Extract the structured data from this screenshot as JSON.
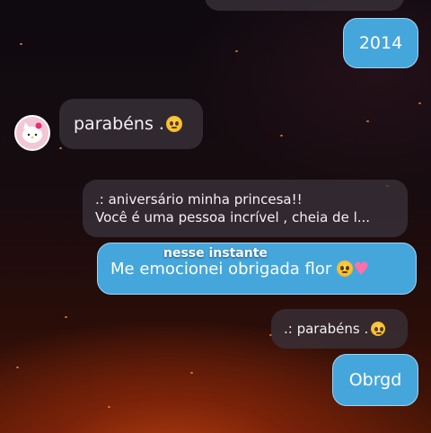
{
  "messages": {
    "top_sent": "2014",
    "received_congrats": "parabéns .",
    "quoted_reply": ".: aniversário minha princesa!!",
    "quoted_reply_line2": "Você é uma pessoa incrível , cheia de l...",
    "caption_overlay": "nesse instante",
    "sent_emotional": "Me emocionei obrigada flor",
    "quoted_small": ".: parabéns .",
    "sent_thanks": "Obrgd"
  },
  "icons": {
    "emoji": "pleading-face-icon",
    "heart": "pink-heart-icon",
    "avatar": "hello-kitty-avatar"
  },
  "colors": {
    "sent_bubble": "#45a6dc",
    "received_bubble": "#3a323a",
    "background_glow": "#b8400e"
  }
}
